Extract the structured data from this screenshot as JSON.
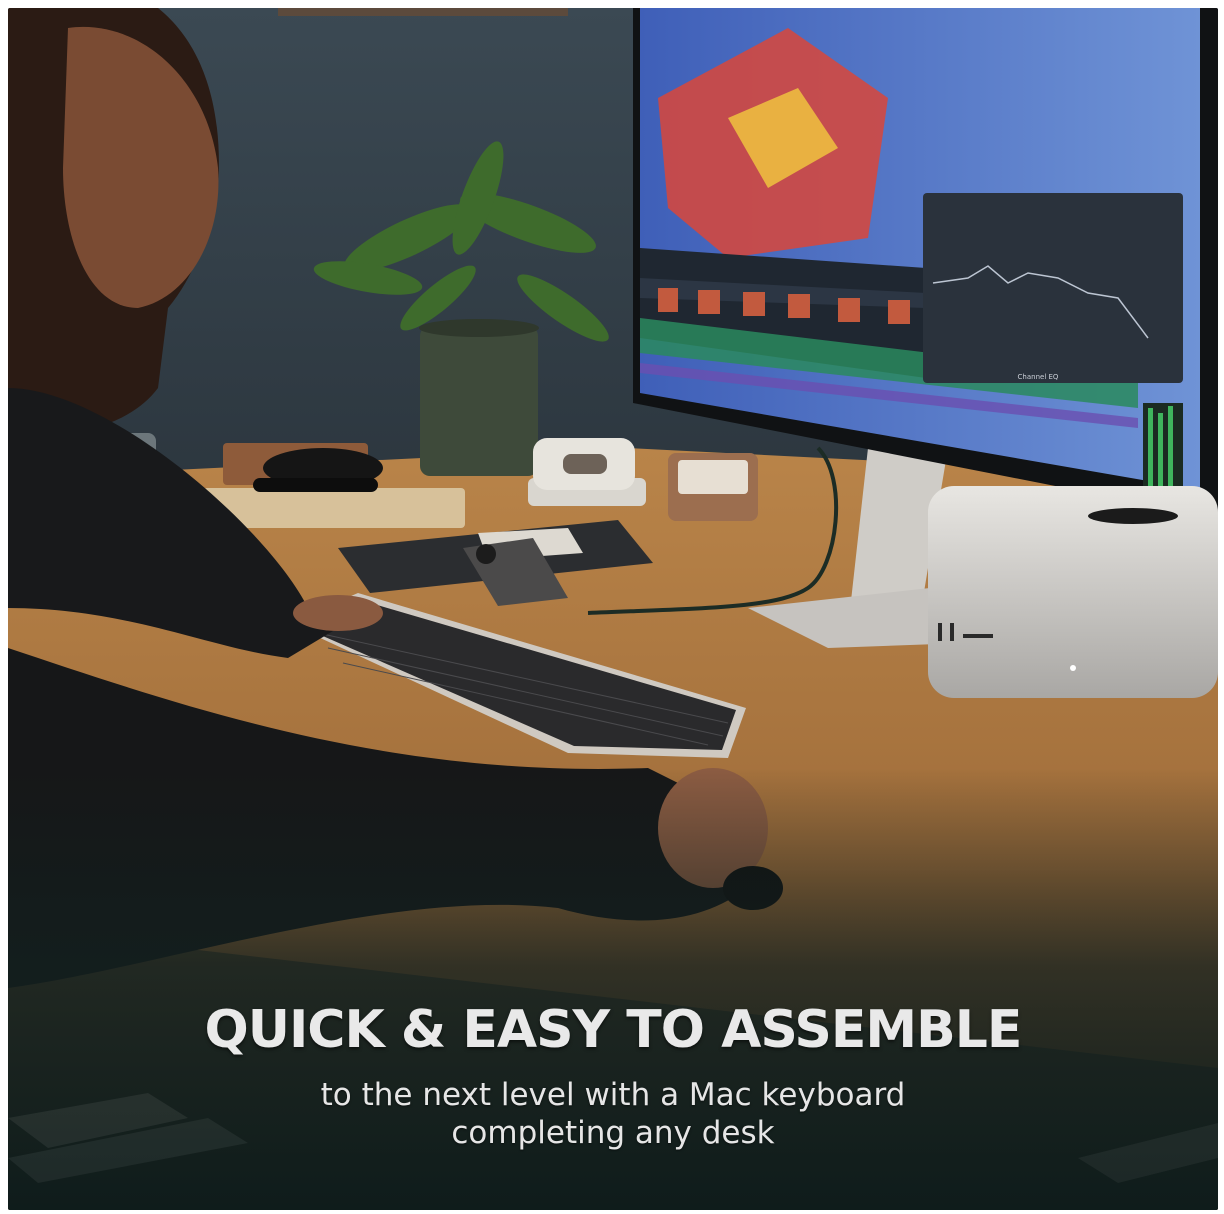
{
  "image": {
    "description_icons": [
      "plant-icon",
      "monitor-icon",
      "keyboard-icon",
      "mac-studio-icon",
      "phone-icon",
      "mouse-icon",
      "glass-icon",
      "stapler-icon",
      "hole-punch-icon"
    ]
  },
  "caption": {
    "headline": "QUICK & EASY TO ASSEMBLE",
    "subtitle_line1": "to the next level with a Mac keyboard",
    "subtitle_line2": "completing any desk"
  },
  "screen": {
    "panel_title": "Channel EQ"
  },
  "colors": {
    "wall": "#33404a",
    "desk": "#b98449",
    "overlay": "#12201f",
    "text": "#e9e9e9"
  }
}
